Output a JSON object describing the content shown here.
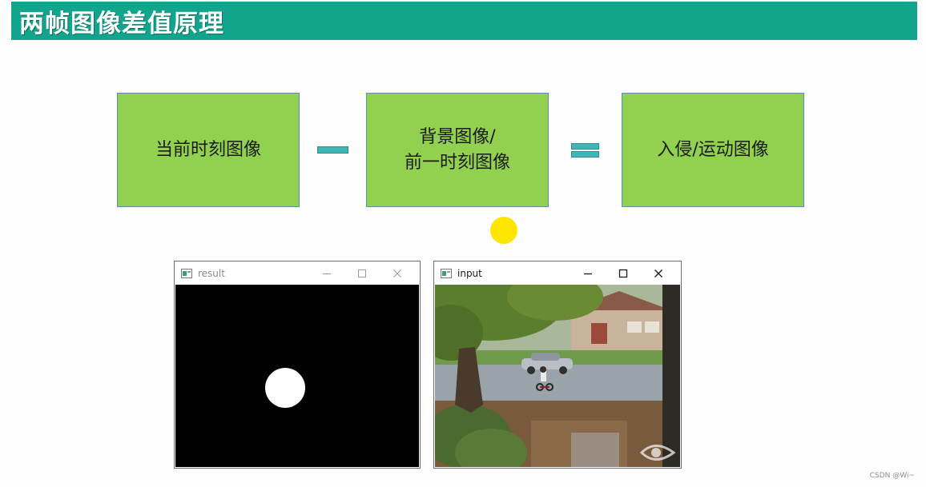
{
  "slide": {
    "title": "两帧图像差值原理"
  },
  "diagram": {
    "box1": {
      "label": "当前时刻图像"
    },
    "box2": {
      "line1": "背景图像/",
      "line2": "前一时刻图像"
    },
    "box3": {
      "label": "入侵/运动图像"
    },
    "colors": {
      "title_bar": "#12a58d",
      "box_fill": "#92d050",
      "box_border": "#5b8fb8",
      "operator": "#3fb5b5",
      "cursor_highlight": "#ffe600"
    }
  },
  "windows": {
    "result": {
      "title": "result",
      "content": "black binary mask with a single white blob"
    },
    "input": {
      "title": "input",
      "content": "street scene with trees, parked car, houses and a child on a tricycle"
    }
  },
  "footer": {
    "watermark": "CSDN @Wi~"
  }
}
